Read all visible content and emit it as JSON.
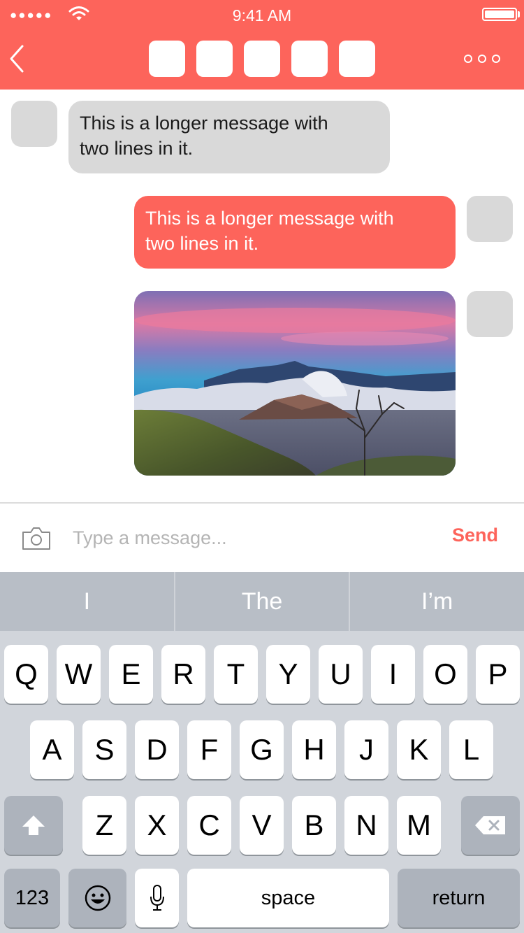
{
  "status_bar": {
    "signal": "●●●●●",
    "time": "9:41 AM"
  },
  "header": {
    "tab_count": 5
  },
  "messages": [
    {
      "type": "received",
      "text_line1": "This is a longer message with",
      "text_line2": "two lines in it."
    },
    {
      "type": "sent",
      "text_line1": "This is a longer message with",
      "text_line2": "two lines in it."
    },
    {
      "type": "sent-image",
      "image": "volcano landscape photo"
    }
  ],
  "composer": {
    "placeholder": "Type a message...",
    "send_label": "Send"
  },
  "keyboard": {
    "suggestions": [
      "I",
      "The",
      "I’m"
    ],
    "row1": [
      "Q",
      "W",
      "E",
      "R",
      "T",
      "Y",
      "U",
      "I",
      "O",
      "P"
    ],
    "row2": [
      "A",
      "S",
      "D",
      "F",
      "G",
      "H",
      "J",
      "K",
      "L"
    ],
    "row3": [
      "Z",
      "X",
      "C",
      "V",
      "B",
      "N",
      "M"
    ],
    "numbers_label": "123",
    "space_label": "space",
    "return_label": "return"
  },
  "colors": {
    "accent": "#fd645b",
    "bubble_in": "#d9d9d9",
    "keyboard_bg": "#d1d5db"
  }
}
